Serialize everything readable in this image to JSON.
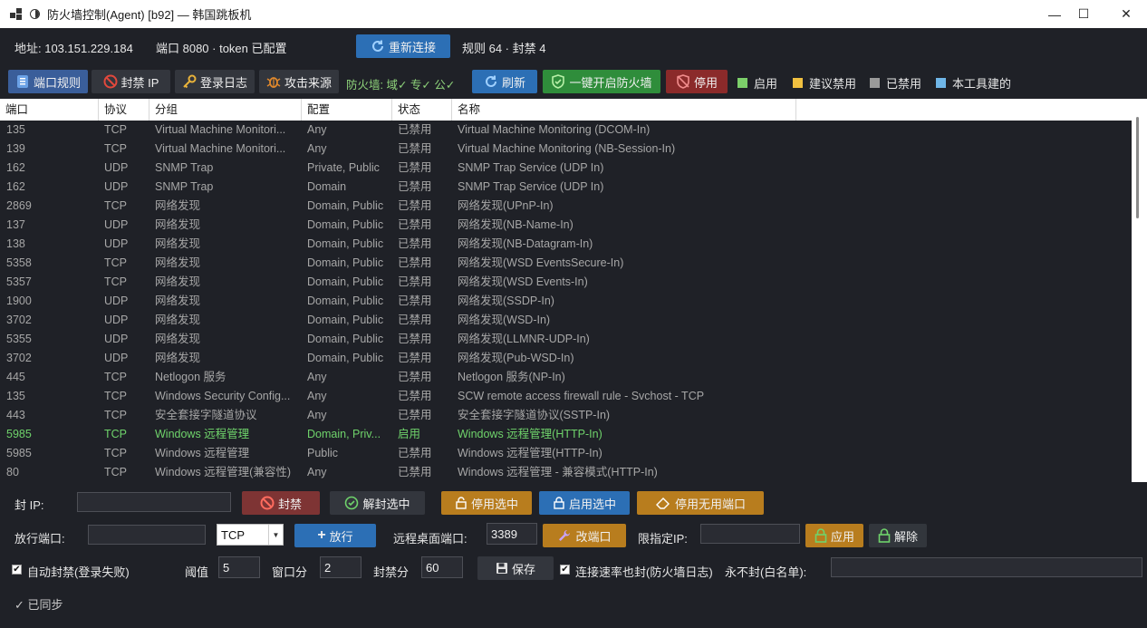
{
  "window": {
    "title": "防火墙控制(Agent) [b92] — 韩国跳板机",
    "minimize": "—",
    "maximize": "☐",
    "close": "✕"
  },
  "header": {
    "address": "地址: 103.151.229.184",
    "port_token": "端口 8080 · token 已配置",
    "reconnect": "重新连接",
    "rules_summary": "规则 64 · 封禁 4"
  },
  "toolbar": {
    "port_rules": "端口规则",
    "block_ip": "封禁 IP",
    "login_log": "登录日志",
    "attack_source": "攻击来源",
    "fw_status": "防火墙: 域✓  专✓  公✓",
    "refresh": "刷新",
    "enable_fw": "一键开启防火墙",
    "disable": "停用",
    "legend": [
      {
        "label": "启用",
        "color": "#7ccf6a"
      },
      {
        "label": "建议禁用",
        "color": "#f0c040"
      },
      {
        "label": "已禁用",
        "color": "#9a9a9a"
      },
      {
        "label": "本工具建的",
        "color": "#6fb6e8"
      }
    ]
  },
  "table": {
    "columns": [
      "端口",
      "协议",
      "分组",
      "配置",
      "状态",
      "名称"
    ],
    "rows": [
      {
        "port": "135",
        "proto": "TCP",
        "group": "Virtual Machine Monitori...",
        "profile": "Any",
        "status": "已禁用",
        "name": "Virtual Machine Monitoring (DCOM-In)",
        "enabled": false
      },
      {
        "port": "139",
        "proto": "TCP",
        "group": "Virtual Machine Monitori...",
        "profile": "Any",
        "status": "已禁用",
        "name": "Virtual Machine Monitoring (NB-Session-In)",
        "enabled": false
      },
      {
        "port": "162",
        "proto": "UDP",
        "group": "SNMP Trap",
        "profile": "Private, Public",
        "status": "已禁用",
        "name": "SNMP Trap Service (UDP In)",
        "enabled": false
      },
      {
        "port": "162",
        "proto": "UDP",
        "group": "SNMP Trap",
        "profile": "Domain",
        "status": "已禁用",
        "name": "SNMP Trap Service (UDP In)",
        "enabled": false
      },
      {
        "port": "2869",
        "proto": "TCP",
        "group": "网络发现",
        "profile": "Domain, Public",
        "status": "已禁用",
        "name": "网络发现(UPnP-In)",
        "enabled": false
      },
      {
        "port": "137",
        "proto": "UDP",
        "group": "网络发现",
        "profile": "Domain, Public",
        "status": "已禁用",
        "name": "网络发现(NB-Name-In)",
        "enabled": false
      },
      {
        "port": "138",
        "proto": "UDP",
        "group": "网络发现",
        "profile": "Domain, Public",
        "status": "已禁用",
        "name": "网络发现(NB-Datagram-In)",
        "enabled": false
      },
      {
        "port": "5358",
        "proto": "TCP",
        "group": "网络发现",
        "profile": "Domain, Public",
        "status": "已禁用",
        "name": "网络发现(WSD EventsSecure-In)",
        "enabled": false
      },
      {
        "port": "5357",
        "proto": "TCP",
        "group": "网络发现",
        "profile": "Domain, Public",
        "status": "已禁用",
        "name": "网络发现(WSD Events-In)",
        "enabled": false
      },
      {
        "port": "1900",
        "proto": "UDP",
        "group": "网络发现",
        "profile": "Domain, Public",
        "status": "已禁用",
        "name": "网络发现(SSDP-In)",
        "enabled": false
      },
      {
        "port": "3702",
        "proto": "UDP",
        "group": "网络发现",
        "profile": "Domain, Public",
        "status": "已禁用",
        "name": "网络发现(WSD-In)",
        "enabled": false
      },
      {
        "port": "5355",
        "proto": "UDP",
        "group": "网络发现",
        "profile": "Domain, Public",
        "status": "已禁用",
        "name": "网络发现(LLMNR-UDP-In)",
        "enabled": false
      },
      {
        "port": "3702",
        "proto": "UDP",
        "group": "网络发现",
        "profile": "Domain, Public",
        "status": "已禁用",
        "name": "网络发现(Pub-WSD-In)",
        "enabled": false
      },
      {
        "port": "445",
        "proto": "TCP",
        "group": "Netlogon 服务",
        "profile": "Any",
        "status": "已禁用",
        "name": "Netlogon 服务(NP-In)",
        "enabled": false
      },
      {
        "port": "135",
        "proto": "TCP",
        "group": "Windows Security Config...",
        "profile": "Any",
        "status": "已禁用",
        "name": "SCW remote access firewall rule - Svchost - TCP",
        "enabled": false
      },
      {
        "port": "443",
        "proto": "TCP",
        "group": "安全套接字隧道协议",
        "profile": "Any",
        "status": "已禁用",
        "name": "安全套接字隧道协议(SSTP-In)",
        "enabled": false
      },
      {
        "port": "5985",
        "proto": "TCP",
        "group": "Windows 远程管理",
        "profile": "Domain, Priv...",
        "status": "启用",
        "name": "Windows 远程管理(HTTP-In)",
        "enabled": true
      },
      {
        "port": "5985",
        "proto": "TCP",
        "group": "Windows 远程管理",
        "profile": "Public",
        "status": "已禁用",
        "name": "Windows 远程管理(HTTP-In)",
        "enabled": false
      },
      {
        "port": "80",
        "proto": "TCP",
        "group": "Windows 远程管理(兼容性)",
        "profile": "Any",
        "status": "已禁用",
        "name": "Windows 远程管理 - 兼容模式(HTTP-In)",
        "enabled": false
      }
    ]
  },
  "ban_row": {
    "label": "封 IP:",
    "ip_value": "",
    "ban": "封禁",
    "unban_selected": "解封选中",
    "disable_selected": "停用选中",
    "enable_selected": "启用选中",
    "disable_unused": "停用无用端口"
  },
  "allow_row": {
    "label": "放行端口:",
    "port_value": "",
    "protocol": "TCP",
    "allow": "放行",
    "rdp_label": "远程桌面端口:",
    "rdp_value": "3389",
    "change_port": "改端口",
    "limit_ip_label": "限指定IP:",
    "limit_ip_value": "",
    "apply": "应用",
    "remove": "解除"
  },
  "auto_row": {
    "auto_ban": "自动封禁(登录失败)",
    "threshold_label": "阈值",
    "threshold_value": "5",
    "window_label": "窗口分",
    "window_value": "2",
    "ban_minutes_label": "封禁分",
    "ban_minutes_value": "60",
    "save": "保存",
    "rate_ban": "连接速率也封(防火墙日志)",
    "whitelist_label": "永不封(白名单):",
    "whitelist_value": ""
  },
  "status": {
    "synced": "✓ 已同步"
  }
}
